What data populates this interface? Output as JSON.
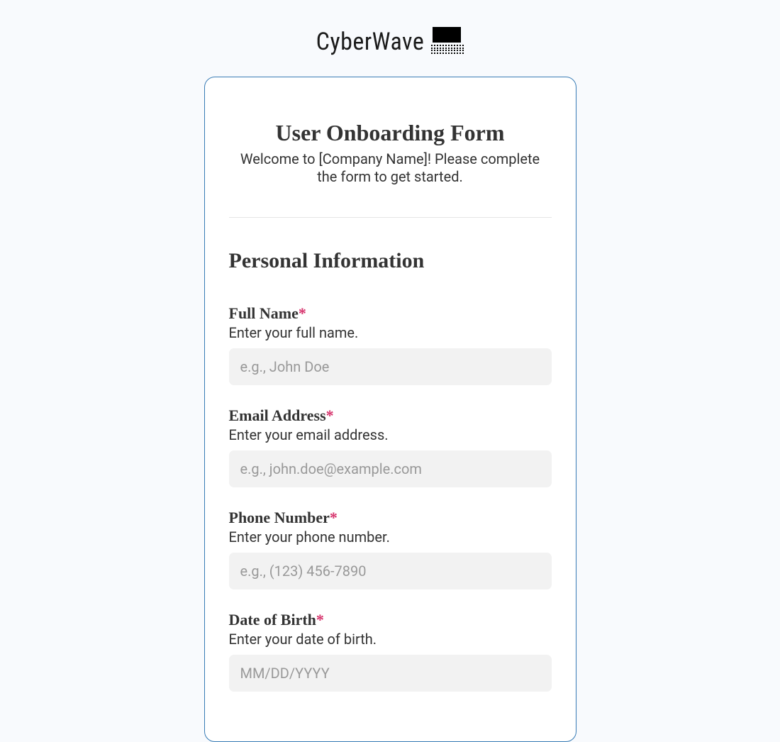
{
  "brand": {
    "name": "CyberWave"
  },
  "form": {
    "title": "User Onboarding Form",
    "subtitle": "Welcome to [Company Name]! Please complete the form to get started.",
    "section_title": "Personal Information",
    "required_marker": "*",
    "fields": [
      {
        "label": "Full Name",
        "required": true,
        "description": "Enter your full name.",
        "placeholder": "e.g., John Doe",
        "value": ""
      },
      {
        "label": "Email Address",
        "required": true,
        "description": "Enter your email address.",
        "placeholder": "e.g., john.doe@example.com",
        "value": ""
      },
      {
        "label": "Phone Number",
        "required": true,
        "description": "Enter your phone number.",
        "placeholder": "e.g., (123) 456-7890",
        "value": ""
      },
      {
        "label": "Date of Birth",
        "required": true,
        "description": "Enter your date of birth.",
        "placeholder": "MM/DD/YYYY",
        "value": ""
      }
    ]
  }
}
